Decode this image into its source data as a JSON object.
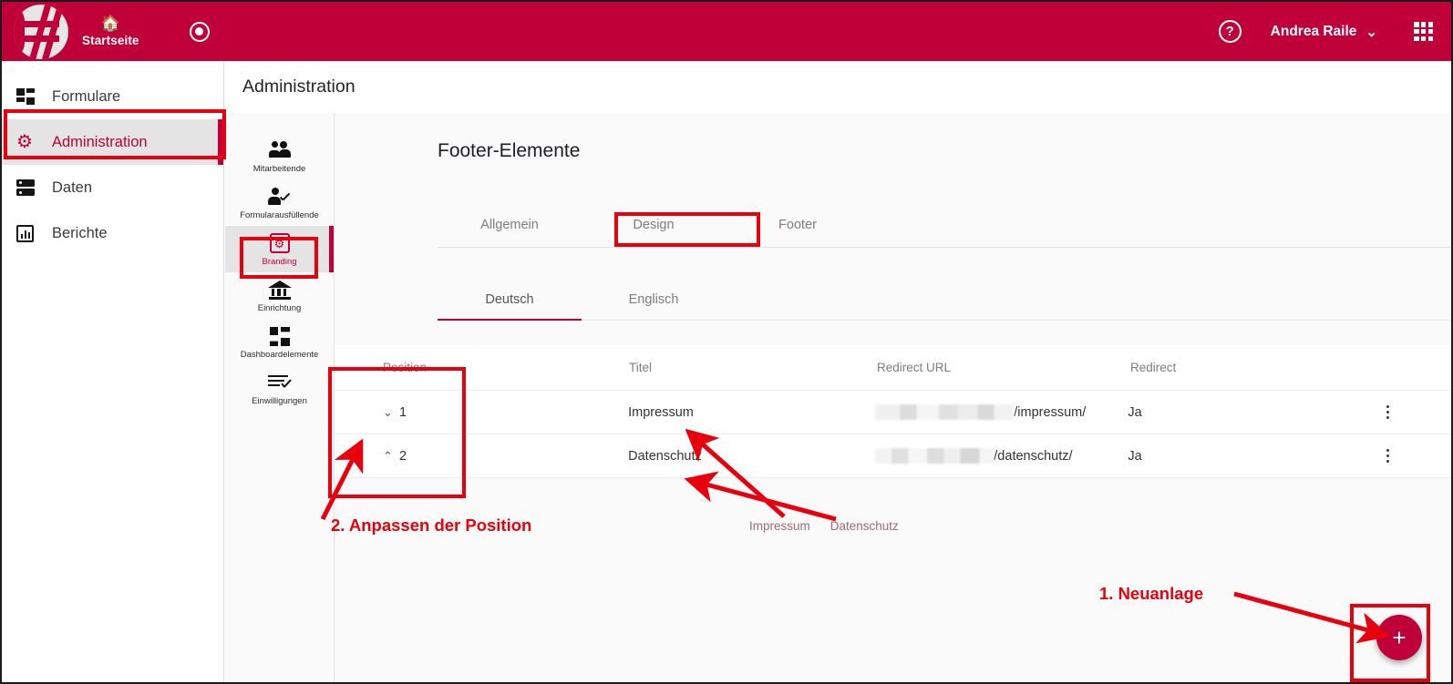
{
  "header": {
    "logo_alt": "app-logo",
    "home_label": "Startseite",
    "home_icon": "home-icon",
    "record_icon": "record-circle-icon",
    "help_icon": "help-circle-icon",
    "user_name": "Andrea Raile",
    "user_chevron": "⌄",
    "apps_icon": "apps-grid-icon",
    "background_color": "#BF0039"
  },
  "sidebar": {
    "items": [
      {
        "label": "Formulare",
        "icon": "forms-icon",
        "active": false
      },
      {
        "label": "Administration",
        "icon": "gear-icon",
        "active": true
      },
      {
        "label": "Daten",
        "icon": "database-icon",
        "active": false
      },
      {
        "label": "Berichte",
        "icon": "bar-chart-icon",
        "active": false
      }
    ]
  },
  "page": {
    "title": "Administration"
  },
  "rail": {
    "items": [
      {
        "label": "Mitarbeitende",
        "icon": "people-icon",
        "active": false
      },
      {
        "label": "Formularausfüllende",
        "icon": "person-check-icon",
        "active": false
      },
      {
        "label": "Branding",
        "icon": "branding-gear-icon",
        "active": true
      },
      {
        "label": "Einrichtung",
        "icon": "bank-icon",
        "active": false
      },
      {
        "label": "Dashboardelemente",
        "icon": "dashboard-icon",
        "active": false
      },
      {
        "label": "Einwilligungen",
        "icon": "consent-list-icon",
        "active": false
      }
    ]
  },
  "panel": {
    "title": "Footer-Elemente",
    "tabs": [
      {
        "label": "Allgemein",
        "active": false
      },
      {
        "label": "Design",
        "active": false
      },
      {
        "label": "Footer",
        "active": true
      }
    ],
    "language_tabs": [
      {
        "label": "Deutsch",
        "active": true
      },
      {
        "label": "Englisch",
        "active": false
      }
    ]
  },
  "table": {
    "columns": [
      "Position",
      "Titel",
      "Redirect URL",
      "Redirect"
    ],
    "rows": [
      {
        "position": "1",
        "position_arrow": "⌄",
        "position_arrow_name": "chevron-down-icon",
        "title": "Impressum",
        "url_redacted": true,
        "url_tail": "/impressum/",
        "redirect": "Ja",
        "menu_icon": "kebab-menu-icon"
      },
      {
        "position": "2",
        "position_arrow": "⌃",
        "position_arrow_name": "chevron-up-icon",
        "title": "Datenschutz",
        "url_redacted": true,
        "url_tail": "/datenschutz/",
        "redirect": "Ja",
        "menu_icon": "kebab-menu-icon"
      }
    ]
  },
  "footer_preview": {
    "links": [
      "Impressum",
      "Datenschutz"
    ]
  },
  "fab": {
    "label": "+",
    "icon": "plus-icon",
    "color": "#BF0039"
  },
  "annotations": {
    "color": "#e8000d",
    "callouts": [
      {
        "text": "2. Anpassen der Position"
      },
      {
        "text": "1. Neuanlage"
      }
    ]
  }
}
